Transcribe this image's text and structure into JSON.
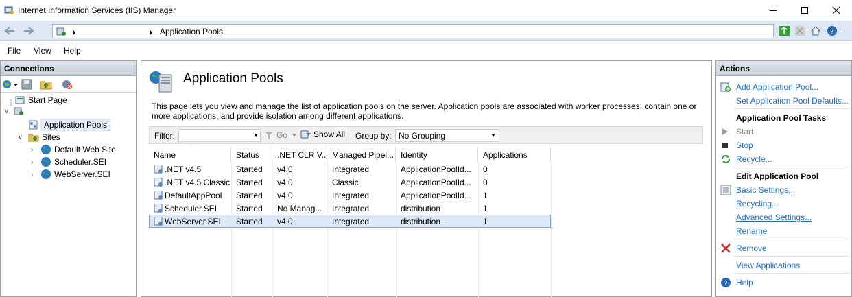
{
  "window": {
    "title": "Internet Information Services (IIS) Manager"
  },
  "address": {
    "breadcrumb": "Application Pools"
  },
  "menu": {
    "file": "File",
    "view": "View",
    "help": "Help"
  },
  "connections": {
    "header": "Connections",
    "tree": {
      "start_page": "Start Page",
      "app_pools": "Application Pools",
      "sites": "Sites",
      "site_items": [
        "Default Web Site",
        "Scheduler.SEI",
        "WebServer.SEI"
      ]
    }
  },
  "content": {
    "title": "Application Pools",
    "description": "This page lets you view and manage the list of application pools on the server. Application pools are associated with worker processes, contain one or more applications, and provide isolation among different applications.",
    "filter": {
      "label": "Filter:",
      "value": "",
      "go": "Go",
      "show_all": "Show All",
      "group_by_label": "Group by:",
      "group_by_value": "No Grouping"
    },
    "columns": [
      "Name",
      "Status",
      ".NET CLR V...",
      "Managed Pipel...",
      "Identity",
      "Applications"
    ],
    "rows": [
      {
        "name": ".NET v4.5",
        "status": "Started",
        "clr": "v4.0",
        "pipeline": "Integrated",
        "identity": "ApplicationPoolId...",
        "apps": "0"
      },
      {
        "name": ".NET v4.5 Classic",
        "status": "Started",
        "clr": "v4.0",
        "pipeline": "Classic",
        "identity": "ApplicationPoolId...",
        "apps": "0"
      },
      {
        "name": "DefaultAppPool",
        "status": "Started",
        "clr": "v4.0",
        "pipeline": "Integrated",
        "identity": "ApplicationPoolId...",
        "apps": "1"
      },
      {
        "name": "Scheduler.SEI",
        "status": "Started",
        "clr": "No Manag...",
        "pipeline": "Integrated",
        "identity": "distribution",
        "apps": "1"
      },
      {
        "name": "WebServer.SEI",
        "status": "Started",
        "clr": "v4.0",
        "pipeline": "Integrated",
        "identity": "distribution",
        "apps": "1"
      }
    ],
    "selected_row": "WebServer.SEI"
  },
  "actions": {
    "header": "Actions",
    "add_pool": "Add Application Pool...",
    "set_defaults": "Set Application Pool Defaults...",
    "tasks_header": "Application Pool Tasks",
    "start": "Start",
    "stop": "Stop",
    "recycle": "Recycle...",
    "edit_header": "Edit Application Pool",
    "basic_settings": "Basic Settings...",
    "recycling": "Recycling...",
    "advanced_settings": "Advanced Settings...",
    "rename": "Rename",
    "remove": "Remove",
    "view_apps": "View Applications",
    "help": "Help"
  },
  "colors": {
    "link": "#1f6fc4",
    "selection": "#dbe8f6",
    "panel_header": "#c8d0da",
    "address_bar": "#dde8f4"
  }
}
